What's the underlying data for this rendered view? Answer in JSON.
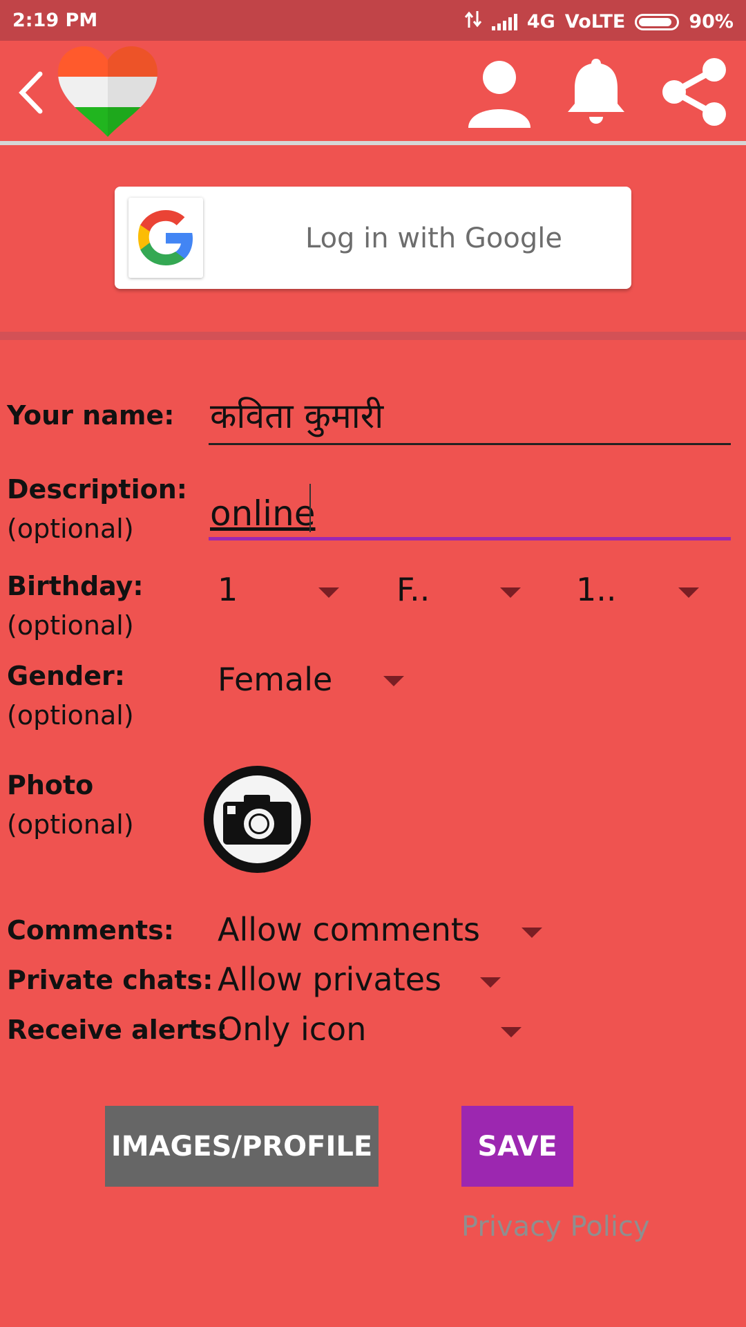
{
  "status_bar": {
    "time": "2:19 PM",
    "network": "4G",
    "volte": "VoLTE",
    "battery": "90%"
  },
  "top_bar": {
    "back_icon": "chevron-left-icon",
    "logo": "india-heart-logo",
    "icons": [
      "user-icon",
      "bell-icon",
      "share-icon"
    ]
  },
  "google": {
    "label": "Log in with Google"
  },
  "form": {
    "name_label": "Your name:",
    "name_value": "कविता कुमारी",
    "description_label": "Description:",
    "description_optional": "(optional)",
    "description_value": "online",
    "birthday_label": "Birthday:",
    "birthday_optional": "(optional)",
    "birthday_day": "1",
    "birthday_month": "F..",
    "birthday_year": "1..",
    "gender_label": "Gender:",
    "gender_optional": "(optional)",
    "gender_value": "Female",
    "photo_label": "Photo",
    "photo_optional": "(optional)",
    "comments_label": "Comments:",
    "comments_value": "Allow comments",
    "private_label": "Private chats:",
    "private_value": "Allow privates",
    "alerts_label": "Receive alerts:",
    "alerts_value": "Only icon"
  },
  "buttons": {
    "images_profile": "IMAGES/PROFILE",
    "save": "SAVE"
  },
  "privacy": "Privacy Policy",
  "colors": {
    "background": "#ef5350",
    "status_bar": "#c14448",
    "save": "#9c27b0",
    "images": "#666666",
    "accent_underline": "#9c27b0"
  }
}
